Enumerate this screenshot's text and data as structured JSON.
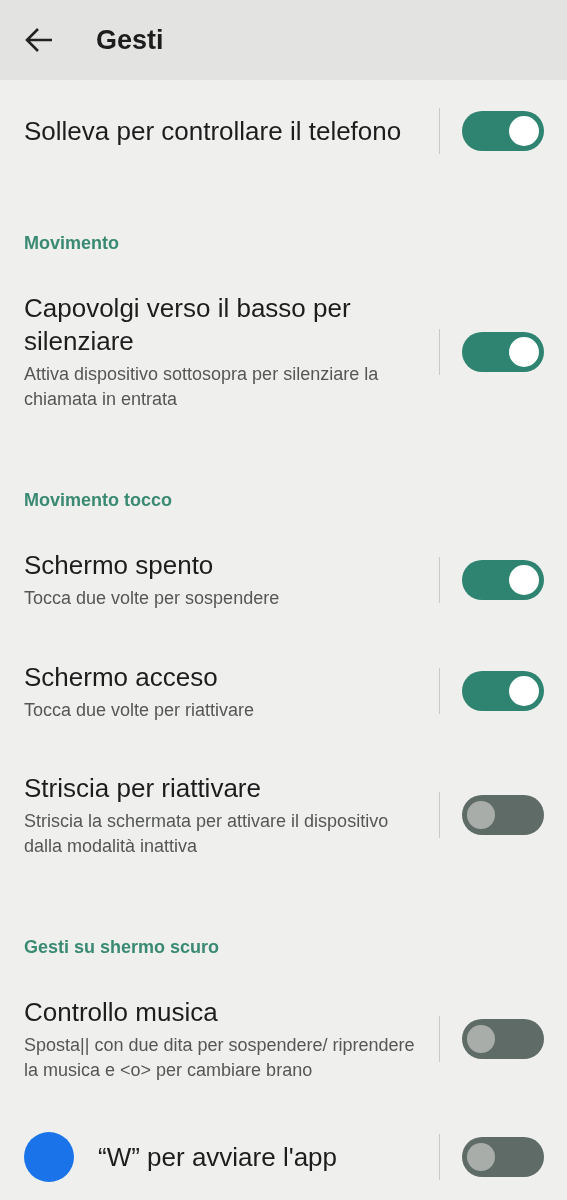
{
  "app_bar": {
    "title": "Gesti"
  },
  "sections": [
    {
      "items": [
        {
          "title": "Solleva per controllare il telefono",
          "on": true
        }
      ]
    },
    {
      "header": "Movimento",
      "items": [
        {
          "title": "Capovolgi verso il basso per silenziare",
          "subtitle": "Attiva dispositivo sottosopra per silenziare la chiamata in entrata",
          "on": true
        }
      ]
    },
    {
      "header": "Movimento tocco",
      "items": [
        {
          "title": "Schermo spento",
          "subtitle": "Tocca due volte per sospendere",
          "on": true
        },
        {
          "title": "Schermo acceso",
          "subtitle": "Tocca due volte per riattivare",
          "on": true
        },
        {
          "title": "Striscia per riattivare",
          "subtitle": "Striscia la schermata per attivare il dispositivo dalla modalità inattiva",
          "on": false
        }
      ]
    },
    {
      "header": "Gesti su shermo scuro",
      "items": [
        {
          "title": "Controllo musica",
          "subtitle": "Sposta|| con due dita per sospendere/ riprendere la musica e <o> per cambiare brano",
          "on": false
        },
        {
          "title": "“W” per avviare l'app",
          "on": false,
          "kind": "app"
        }
      ]
    }
  ]
}
